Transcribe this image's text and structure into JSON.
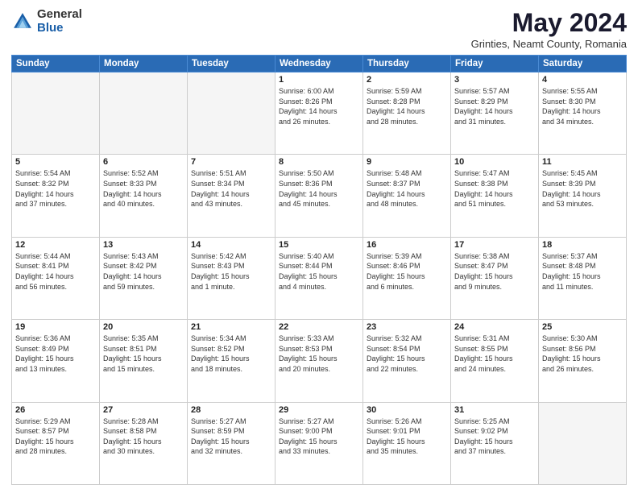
{
  "logo": {
    "general": "General",
    "blue": "Blue"
  },
  "header": {
    "title": "May 2024",
    "subtitle": "Grinties, Neamt County, Romania"
  },
  "days_of_week": [
    "Sunday",
    "Monday",
    "Tuesday",
    "Wednesday",
    "Thursday",
    "Friday",
    "Saturday"
  ],
  "weeks": [
    [
      {
        "day": "",
        "info": ""
      },
      {
        "day": "",
        "info": ""
      },
      {
        "day": "",
        "info": ""
      },
      {
        "day": "1",
        "info": "Sunrise: 6:00 AM\nSunset: 8:26 PM\nDaylight: 14 hours\nand 26 minutes."
      },
      {
        "day": "2",
        "info": "Sunrise: 5:59 AM\nSunset: 8:28 PM\nDaylight: 14 hours\nand 28 minutes."
      },
      {
        "day": "3",
        "info": "Sunrise: 5:57 AM\nSunset: 8:29 PM\nDaylight: 14 hours\nand 31 minutes."
      },
      {
        "day": "4",
        "info": "Sunrise: 5:55 AM\nSunset: 8:30 PM\nDaylight: 14 hours\nand 34 minutes."
      }
    ],
    [
      {
        "day": "5",
        "info": "Sunrise: 5:54 AM\nSunset: 8:32 PM\nDaylight: 14 hours\nand 37 minutes."
      },
      {
        "day": "6",
        "info": "Sunrise: 5:52 AM\nSunset: 8:33 PM\nDaylight: 14 hours\nand 40 minutes."
      },
      {
        "day": "7",
        "info": "Sunrise: 5:51 AM\nSunset: 8:34 PM\nDaylight: 14 hours\nand 43 minutes."
      },
      {
        "day": "8",
        "info": "Sunrise: 5:50 AM\nSunset: 8:36 PM\nDaylight: 14 hours\nand 45 minutes."
      },
      {
        "day": "9",
        "info": "Sunrise: 5:48 AM\nSunset: 8:37 PM\nDaylight: 14 hours\nand 48 minutes."
      },
      {
        "day": "10",
        "info": "Sunrise: 5:47 AM\nSunset: 8:38 PM\nDaylight: 14 hours\nand 51 minutes."
      },
      {
        "day": "11",
        "info": "Sunrise: 5:45 AM\nSunset: 8:39 PM\nDaylight: 14 hours\nand 53 minutes."
      }
    ],
    [
      {
        "day": "12",
        "info": "Sunrise: 5:44 AM\nSunset: 8:41 PM\nDaylight: 14 hours\nand 56 minutes."
      },
      {
        "day": "13",
        "info": "Sunrise: 5:43 AM\nSunset: 8:42 PM\nDaylight: 14 hours\nand 59 minutes."
      },
      {
        "day": "14",
        "info": "Sunrise: 5:42 AM\nSunset: 8:43 PM\nDaylight: 15 hours\nand 1 minute."
      },
      {
        "day": "15",
        "info": "Sunrise: 5:40 AM\nSunset: 8:44 PM\nDaylight: 15 hours\nand 4 minutes."
      },
      {
        "day": "16",
        "info": "Sunrise: 5:39 AM\nSunset: 8:46 PM\nDaylight: 15 hours\nand 6 minutes."
      },
      {
        "day": "17",
        "info": "Sunrise: 5:38 AM\nSunset: 8:47 PM\nDaylight: 15 hours\nand 9 minutes."
      },
      {
        "day": "18",
        "info": "Sunrise: 5:37 AM\nSunset: 8:48 PM\nDaylight: 15 hours\nand 11 minutes."
      }
    ],
    [
      {
        "day": "19",
        "info": "Sunrise: 5:36 AM\nSunset: 8:49 PM\nDaylight: 15 hours\nand 13 minutes."
      },
      {
        "day": "20",
        "info": "Sunrise: 5:35 AM\nSunset: 8:51 PM\nDaylight: 15 hours\nand 15 minutes."
      },
      {
        "day": "21",
        "info": "Sunrise: 5:34 AM\nSunset: 8:52 PM\nDaylight: 15 hours\nand 18 minutes."
      },
      {
        "day": "22",
        "info": "Sunrise: 5:33 AM\nSunset: 8:53 PM\nDaylight: 15 hours\nand 20 minutes."
      },
      {
        "day": "23",
        "info": "Sunrise: 5:32 AM\nSunset: 8:54 PM\nDaylight: 15 hours\nand 22 minutes."
      },
      {
        "day": "24",
        "info": "Sunrise: 5:31 AM\nSunset: 8:55 PM\nDaylight: 15 hours\nand 24 minutes."
      },
      {
        "day": "25",
        "info": "Sunrise: 5:30 AM\nSunset: 8:56 PM\nDaylight: 15 hours\nand 26 minutes."
      }
    ],
    [
      {
        "day": "26",
        "info": "Sunrise: 5:29 AM\nSunset: 8:57 PM\nDaylight: 15 hours\nand 28 minutes."
      },
      {
        "day": "27",
        "info": "Sunrise: 5:28 AM\nSunset: 8:58 PM\nDaylight: 15 hours\nand 30 minutes."
      },
      {
        "day": "28",
        "info": "Sunrise: 5:27 AM\nSunset: 8:59 PM\nDaylight: 15 hours\nand 32 minutes."
      },
      {
        "day": "29",
        "info": "Sunrise: 5:27 AM\nSunset: 9:00 PM\nDaylight: 15 hours\nand 33 minutes."
      },
      {
        "day": "30",
        "info": "Sunrise: 5:26 AM\nSunset: 9:01 PM\nDaylight: 15 hours\nand 35 minutes."
      },
      {
        "day": "31",
        "info": "Sunrise: 5:25 AM\nSunset: 9:02 PM\nDaylight: 15 hours\nand 37 minutes."
      },
      {
        "day": "",
        "info": ""
      }
    ]
  ]
}
